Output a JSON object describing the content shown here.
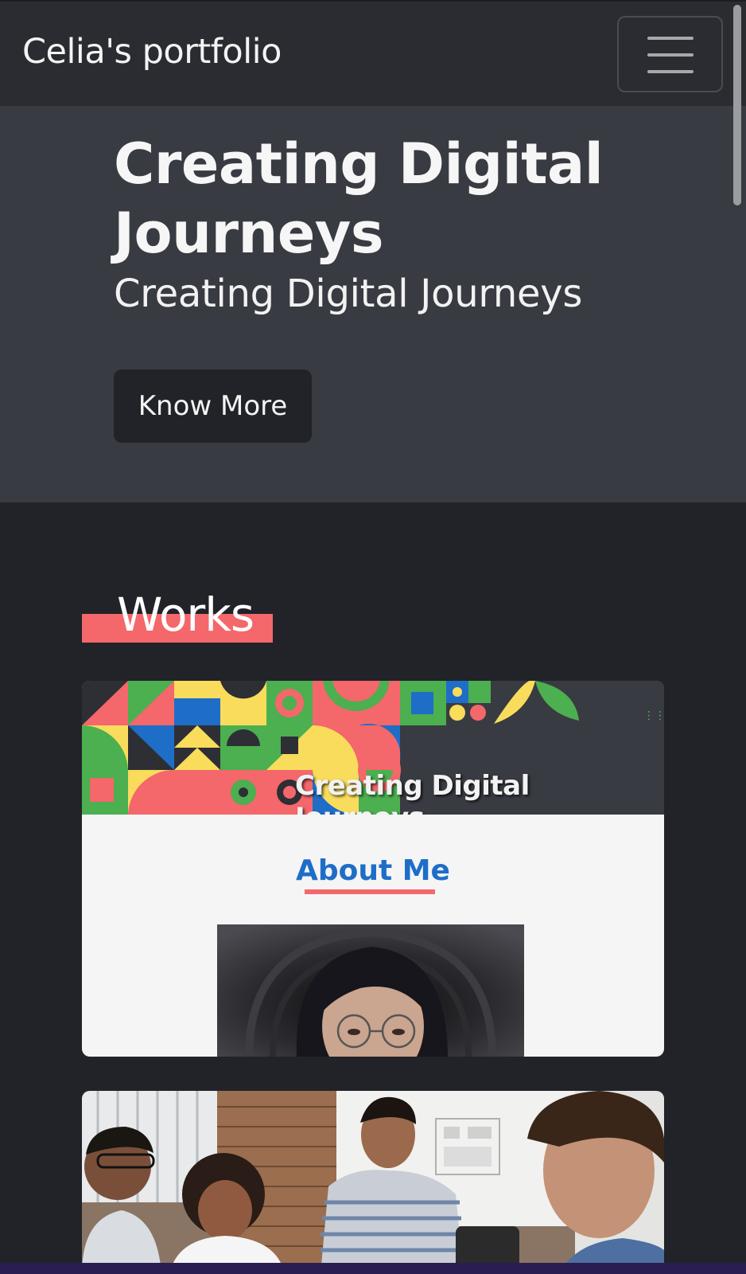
{
  "navbar": {
    "brand": "Celia's portfolio",
    "toggle_icon": "hamburger-menu-icon"
  },
  "hero": {
    "title": "Creating Digital Journeys",
    "subtitle": "Creating Digital Journeys",
    "button_label": "Know More"
  },
  "works": {
    "heading": "Works",
    "cards": [
      {
        "banner_title": "Creating Digital Journeys",
        "section_heading": "About Me",
        "image": "portrait-illustration"
      },
      {
        "image": "team-meeting-photo"
      }
    ]
  },
  "colors": {
    "accent": "#f4676b",
    "link_blue": "#1e6ec8",
    "navbar_bg": "#2a2c31",
    "hero_bg": "#393b42",
    "page_bg": "#212328"
  }
}
